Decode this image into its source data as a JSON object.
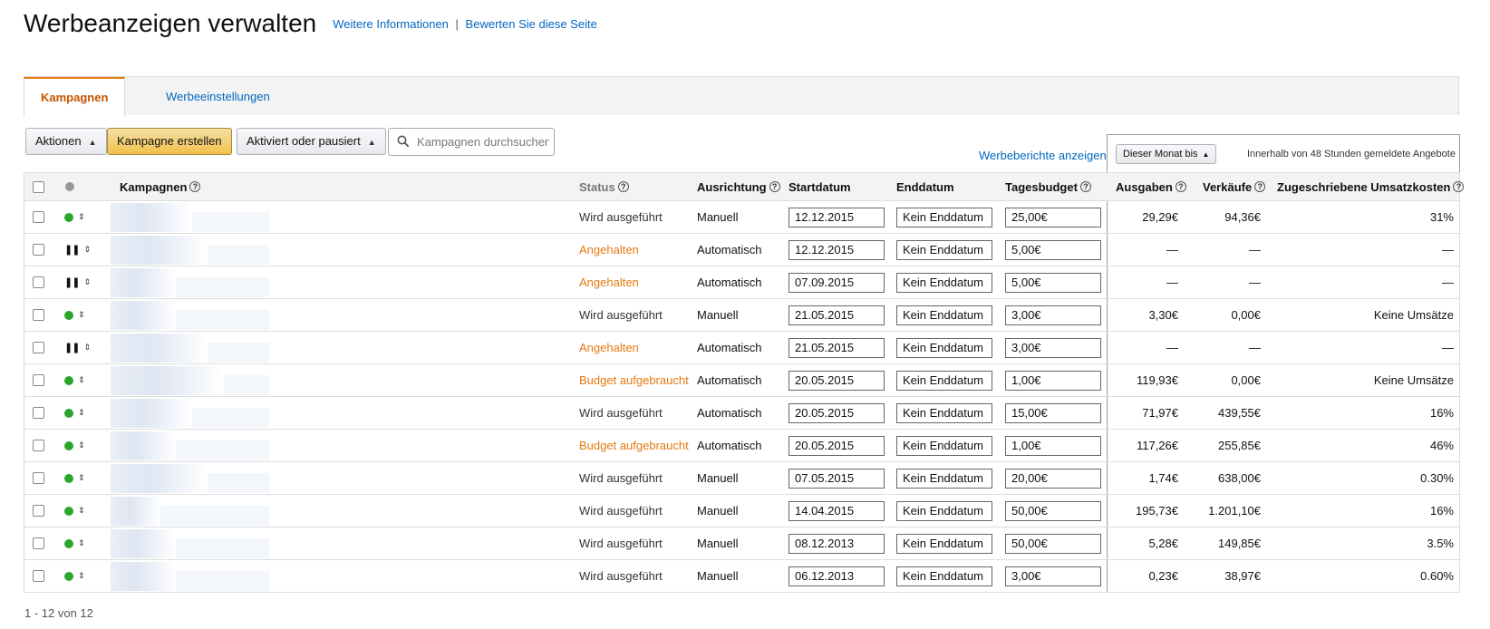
{
  "header": {
    "title": "Werbeanzeigen verwalten",
    "link_info": "Weitere Informationen",
    "separator": "|",
    "link_rate": "Bewerten Sie diese Seite"
  },
  "tabs": [
    {
      "label": "Kampagnen",
      "active": true
    },
    {
      "label": "Werbeeinstellungen",
      "active": false
    }
  ],
  "toolbar": {
    "actions_label": "Aktionen",
    "create_label": "Kampagne erstellen",
    "filter_label": "Aktiviert oder pausiert",
    "search_placeholder": "Kampagnen durchsuchen",
    "reports_link": "Werbeberichte anzeigen",
    "month_label": "Dieser Monat bis",
    "panel_note": "Innerhalb von 48 Stunden gemeldete Angebote"
  },
  "columns": {
    "campaigns": "Kampagnen",
    "status": "Status",
    "targeting": "Ausrichtung",
    "start": "Startdatum",
    "end": "Enddatum",
    "budget": "Tagesbudget",
    "spend": "Ausgaben",
    "sales": "Verkäufe",
    "acos": "Zugeschriebene Umsatzkosten"
  },
  "rows": [
    {
      "state": "running",
      "status": "Wird ausgeführt",
      "status_type": "run",
      "targeting": "Manuell",
      "start": "12.12.2015",
      "end": "Kein Enddatum",
      "budget": "25,00€",
      "spend": "29,29€",
      "sales": "94,36€",
      "acos": "31%"
    },
    {
      "state": "paused",
      "status": "Angehalten",
      "status_type": "warn",
      "targeting": "Automatisch",
      "start": "12.12.2015",
      "end": "Kein Enddatum",
      "budget": "5,00€",
      "spend": "—",
      "sales": "—",
      "acos": "—"
    },
    {
      "state": "paused",
      "status": "Angehalten",
      "status_type": "warn",
      "targeting": "Automatisch",
      "start": "07.09.2015",
      "end": "Kein Enddatum",
      "budget": "5,00€",
      "spend": "—",
      "sales": "—",
      "acos": "—"
    },
    {
      "state": "running",
      "status": "Wird ausgeführt",
      "status_type": "run",
      "targeting": "Manuell",
      "start": "21.05.2015",
      "end": "Kein Enddatum",
      "budget": "3,00€",
      "spend": "3,30€",
      "sales": "0,00€",
      "acos": "Keine Umsätze"
    },
    {
      "state": "paused",
      "status": "Angehalten",
      "status_type": "warn",
      "targeting": "Automatisch",
      "start": "21.05.2015",
      "end": "Kein Enddatum",
      "budget": "3,00€",
      "spend": "—",
      "sales": "—",
      "acos": "—"
    },
    {
      "state": "running",
      "status": "Budget aufgebraucht",
      "status_type": "warn",
      "targeting": "Automatisch",
      "start": "20.05.2015",
      "end": "Kein Enddatum",
      "budget": "1,00€",
      "spend": "119,93€",
      "sales": "0,00€",
      "acos": "Keine Umsätze"
    },
    {
      "state": "running",
      "status": "Wird ausgeführt",
      "status_type": "run",
      "targeting": "Automatisch",
      "start": "20.05.2015",
      "end": "Kein Enddatum",
      "budget": "15,00€",
      "spend": "71,97€",
      "sales": "439,55€",
      "acos": "16%"
    },
    {
      "state": "running",
      "status": "Budget aufgebraucht",
      "status_type": "warn",
      "targeting": "Automatisch",
      "start": "20.05.2015",
      "end": "Kein Enddatum",
      "budget": "1,00€",
      "spend": "117,26€",
      "sales": "255,85€",
      "acos": "46%"
    },
    {
      "state": "running",
      "status": "Wird ausgeführt",
      "status_type": "run",
      "targeting": "Manuell",
      "start": "07.05.2015",
      "end": "Kein Enddatum",
      "budget": "20,00€",
      "spend": "1,74€",
      "sales": "638,00€",
      "acos": "0.30%"
    },
    {
      "state": "running",
      "status": "Wird ausgeführt",
      "status_type": "run",
      "targeting": "Manuell",
      "start": "14.04.2015",
      "end": "Kein Enddatum",
      "budget": "50,00€",
      "spend": "195,73€",
      "sales": "1.201,10€",
      "acos": "16%"
    },
    {
      "state": "running",
      "status": "Wird ausgeführt",
      "status_type": "run",
      "targeting": "Manuell",
      "start": "08.12.2013",
      "end": "Kein Enddatum",
      "budget": "50,00€",
      "spend": "5,28€",
      "sales": "149,85€",
      "acos": "3.5%"
    },
    {
      "state": "running",
      "status": "Wird ausgeführt",
      "status_type": "run",
      "targeting": "Manuell",
      "start": "06.12.2013",
      "end": "Kein Enddatum",
      "budget": "3,00€",
      "spend": "0,23€",
      "sales": "38,97€",
      "acos": "0.60%"
    }
  ],
  "pagination": "1 - 12 von 12"
}
